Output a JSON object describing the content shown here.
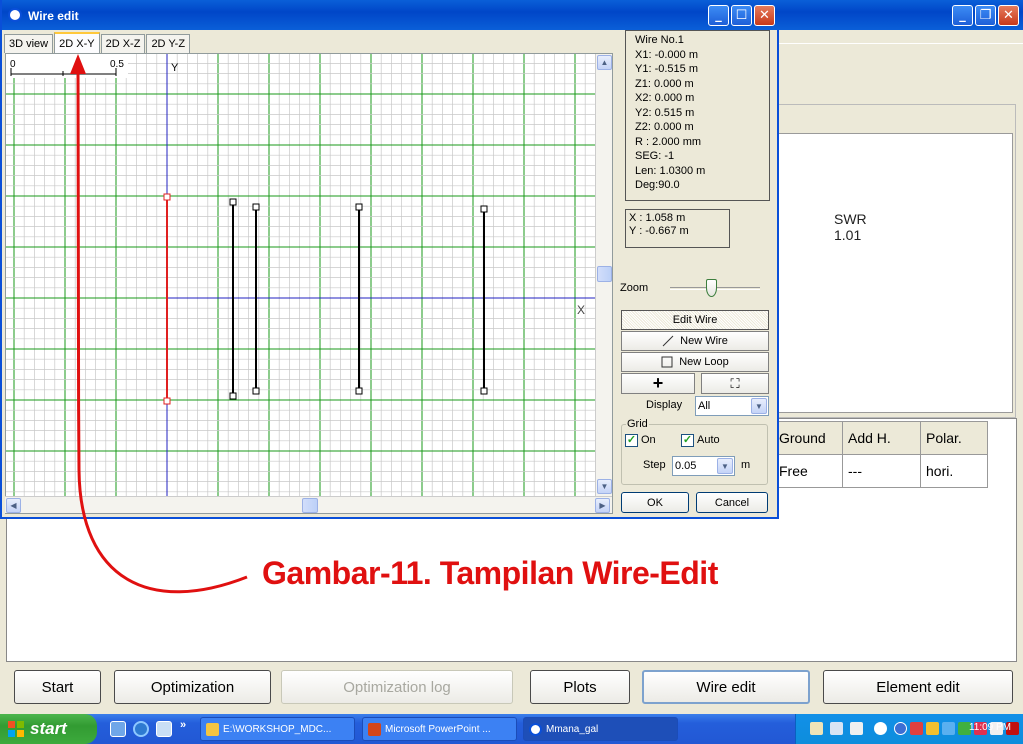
{
  "app": {
    "buttons": [
      {
        "label": "Start",
        "enabled": true
      },
      {
        "label": "Optimization",
        "enabled": true
      },
      {
        "label": "Optimization log",
        "enabled": false
      },
      {
        "label": "Plots",
        "enabled": true
      },
      {
        "label": "Wire edit",
        "enabled": true
      },
      {
        "label": "Element edit",
        "enabled": true
      }
    ],
    "swr_label": "SWR",
    "swr_value": "1.01",
    "params_table": {
      "headers": [
        "Ground",
        "Add H.",
        "Polar."
      ],
      "row": [
        "Free",
        "---",
        "hori."
      ]
    }
  },
  "dialog": {
    "title": "Wire edit",
    "tabs": [
      "3D view",
      "2D X-Y",
      "2D X-Z",
      "2D Y-Z"
    ],
    "active_tab": "2D X-Y",
    "ruler": {
      "start": "0",
      "end": "0.5"
    },
    "axis_labels": {
      "y": "Y",
      "x": "X"
    },
    "wire_info": [
      "Wire No.1",
      "X1: -0.000 m",
      "Y1: -0.515 m",
      "Z1: 0.000 m",
      "X2: 0.000 m",
      "Y2: 0.515 m",
      "Z2: 0.000 m",
      "R : 2.000 mm",
      "SEG: -1",
      "Len: 1.0300 m",
      "Deg:90.0"
    ],
    "cursor_pos": [
      "X : 1.058 m",
      "Y : -0.667 m"
    ],
    "zoom_label": "Zoom",
    "zoom_level": 0.45,
    "edit_wire_label": "Edit Wire",
    "new_wire_label": "New Wire",
    "new_loop_label": "New Loop",
    "plus_label": "+",
    "fit_label": "⛶",
    "display_label": "Display",
    "display_value": "All",
    "grid_label": "Grid",
    "grid_on_label": "On",
    "grid_on_checked": true,
    "grid_auto_label": "Auto",
    "grid_auto_checked": true,
    "step_label": "Step",
    "step_value": "0.05",
    "step_unit": "m",
    "ok_label": "OK",
    "cancel_label": "Cancel",
    "selected_wire_color": "#E02020"
  },
  "annotation": {
    "caption": "Gambar-11. Tampilan Wire-Edit",
    "color": "#E01010"
  },
  "taskbar": {
    "start_label": "start",
    "chevron": "»",
    "items": [
      {
        "label": "E:\\WORKSHOP_MDC...",
        "active": false
      },
      {
        "label": "Microsoft PowerPoint ...",
        "active": false
      },
      {
        "label": "Mmana_gal",
        "active": true
      }
    ],
    "clock": "11:09 PM"
  }
}
